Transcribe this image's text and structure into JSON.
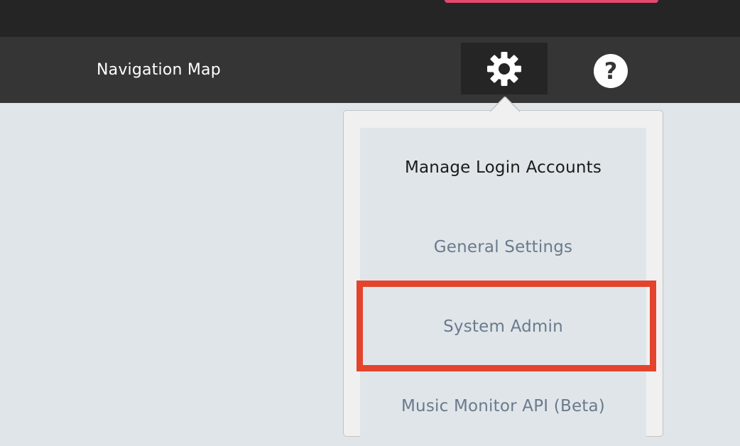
{
  "header": {
    "nav_title": "Navigation Map",
    "accent_color": "#e5486d"
  },
  "toolbar": {
    "settings_icon": "gear-icon",
    "help_icon": "help-icon"
  },
  "settings_menu": {
    "items": [
      {
        "label": "Manage Login Accounts",
        "active": true
      },
      {
        "label": "General Settings",
        "active": false
      },
      {
        "label": "System Admin",
        "active": false,
        "highlighted": true
      },
      {
        "label": "Music Monitor API (Beta)",
        "active": false
      }
    ],
    "highlight_color": "#e4442b"
  }
}
